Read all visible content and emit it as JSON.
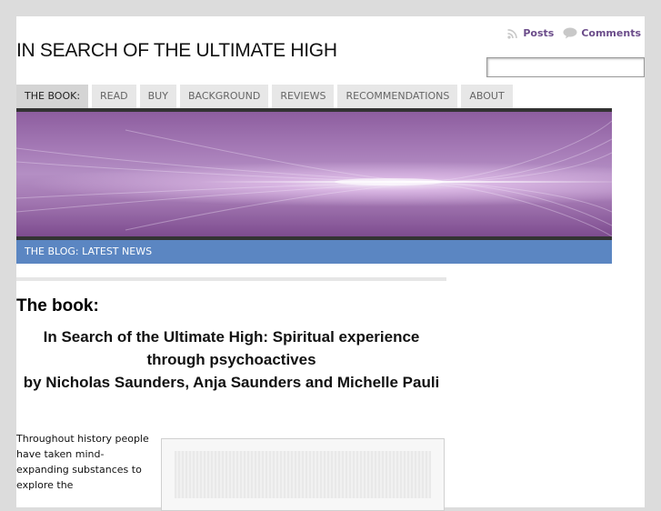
{
  "header": {
    "site_title": "IN SEARCH OF THE ULTIMATE HIGH",
    "feeds": {
      "posts_label": "Posts",
      "comments_label": "Comments"
    },
    "search": {
      "value": ""
    }
  },
  "nav": {
    "tabs": [
      {
        "label": "THE BOOK:",
        "active": true
      },
      {
        "label": "READ"
      },
      {
        "label": "BUY"
      },
      {
        "label": "BACKGROUND"
      },
      {
        "label": "REVIEWS"
      },
      {
        "label": "RECOMMENDATIONS"
      },
      {
        "label": "ABOUT"
      }
    ]
  },
  "blog_bar": {
    "label": "THE BLOG: LATEST NEWS"
  },
  "main": {
    "heading": "The book:",
    "book_title_line1": "In Search of the Ultimate High: Spiritual experience through psychoactives",
    "book_title_line2": "by Nicholas Saunders, Anja Saunders and Michelle Pauli",
    "intro_text": "Throughout history people have taken mind-expanding substances to explore the"
  },
  "colors": {
    "page_background": "#dcdcdc",
    "accent_link": "#6b4c8a",
    "blog_bar": "#5b86c2",
    "nav_tab": "#e7e7e7",
    "nav_tab_active": "#d4d4d4"
  }
}
